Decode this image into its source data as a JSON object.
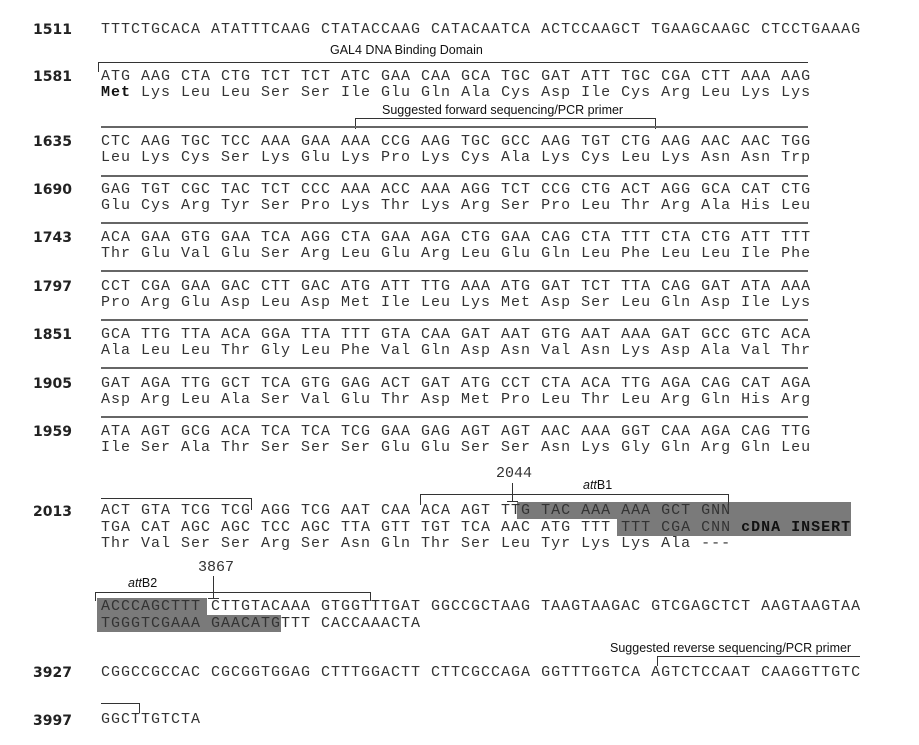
{
  "blocks": [
    {
      "num": "1511",
      "lines": [
        "TTTCTGCACA ATATTTCAAG CTATACCAAG CATACAATCA ACTCCAAGCT TGAAGCAAGC CTCCTGAAAG"
      ]
    },
    {
      "num": "1581",
      "lines": [
        "ATG AAG CTA CTG TCT TCT ATC GAA CAA GCA TGC GAT ATT TGC CGA CTT AAA AAG"
      ],
      "protein_bold": "Met",
      "protein_rest": " Lys Leu Leu Ser Ser Ile Glu Gln Ala Cys Asp Ile Cys Arg Leu Lys Lys"
    },
    {
      "num": "1635",
      "lines": [
        "CTC AAG TGC TCC AAA GAA AAA CCG AAG TGC GCC AAG TGT CTG AAG AAC AAC TGG",
        "Leu Lys Cys Ser Lys Glu Lys Pro Lys Cys Ala Lys Cys Leu Lys Asn Asn Trp"
      ]
    },
    {
      "num": "1690",
      "lines": [
        "GAG TGT CGC TAC TCT CCC AAA ACC AAA AGG TCT CCG CTG ACT AGG GCA CAT CTG",
        "Glu Cys Arg Tyr Ser Pro Lys Thr Lys Arg Ser Pro Leu Thr Arg Ala His Leu"
      ]
    },
    {
      "num": "1743",
      "lines": [
        "ACA GAA GTG GAA TCA AGG CTA GAA AGA CTG GAA CAG CTA TTT CTA CTG ATT TTT",
        "Thr Glu Val Glu Ser Arg Leu Glu Arg Leu Glu Gln Leu Phe Leu Leu Ile Phe"
      ]
    },
    {
      "num": "1797",
      "lines": [
        "CCT CGA GAA GAC CTT GAC ATG ATT TTG AAA ATG GAT TCT TTA CAG GAT ATA AAA",
        "Pro Arg Glu Asp Leu Asp Met Ile Leu Lys Met Asp Ser Leu Gln Asp Ile Lys"
      ]
    },
    {
      "num": "1851",
      "lines": [
        "GCA TTG TTA ACA GGA TTA TTT GTA CAA GAT AAT GTG AAT AAA GAT GCC GTC ACA",
        "Ala Leu Leu Thr Gly Leu Phe Val Gln Asp Asn Val Asn Lys Asp Ala Val Thr"
      ]
    },
    {
      "num": "1905",
      "lines": [
        "GAT AGA TTG GCT TCA GTG GAG ACT GAT ATG CCT CTA ACA TTG AGA CAG CAT AGA",
        "Asp Arg Leu Ala Ser Val Glu Thr Asp Met Pro Leu Thr Leu Arg Gln His Arg"
      ]
    },
    {
      "num": "1959",
      "lines": [
        "ATA AGT GCG ACA TCA TCA TCG GAA GAG AGT AGT AAC AAA GGT CAA AGA CAG TTG",
        "Ile Ser Ala Thr Ser Ser Ser Glu Glu Ser Ser Asn Lys Gly Gln Arg Gln Leu"
      ]
    },
    {
      "num": "2013",
      "lines": [
        "ACT GTA TCG TCG AGG TCG AAT CAA ACA AGT TTG TAC AAA AAA GCT GNN",
        "Thr Val Ser Ser Arg Ser Asn Gln Thr Ser Leu Tyr Lys Lys Ala ---"
      ],
      "comp": "TGA CAT AGC AGC TCC AGC TTA GTT TGT TCA AAC ATG TTT TTT CGA CNN ",
      "comp_bold": "cDNA INSERT"
    },
    {
      "num": "",
      "lines": [
        "ACCCAGCTTT CTTGTACAAA GTGGTTTGAT GGCCGCTAAG TAAGTAAGAC GTCGAGCTCT AAGTAAGTAA",
        "TGGGTCGAAA GAACATGTTT CACCAAACTA"
      ]
    },
    {
      "num": "3927",
      "lines": [
        "CGGCCGCCAC CGCGGTGGAG CTTTGGACTT CTTCGCCAGA GGTTTGGTCA AGTCTCCAAT CAAGGTTGTC"
      ]
    },
    {
      "num": "3997",
      "lines": [
        "GGCTTGTCTA"
      ]
    }
  ],
  "annotations": {
    "gal4": "GAL4 DNA Binding Domain",
    "forward_primer": "Suggested forward sequencing/PCR primer",
    "reverse_primer": "Suggested reverse sequencing/PCR primer",
    "attb1_italic": "att",
    "attb1_rest": "B1",
    "attb2_italic": "att",
    "attb2_rest": "B2",
    "pos_2044": "2044",
    "pos_3867": "3867"
  },
  "colors": {
    "highlight": "#7a7a7a"
  }
}
